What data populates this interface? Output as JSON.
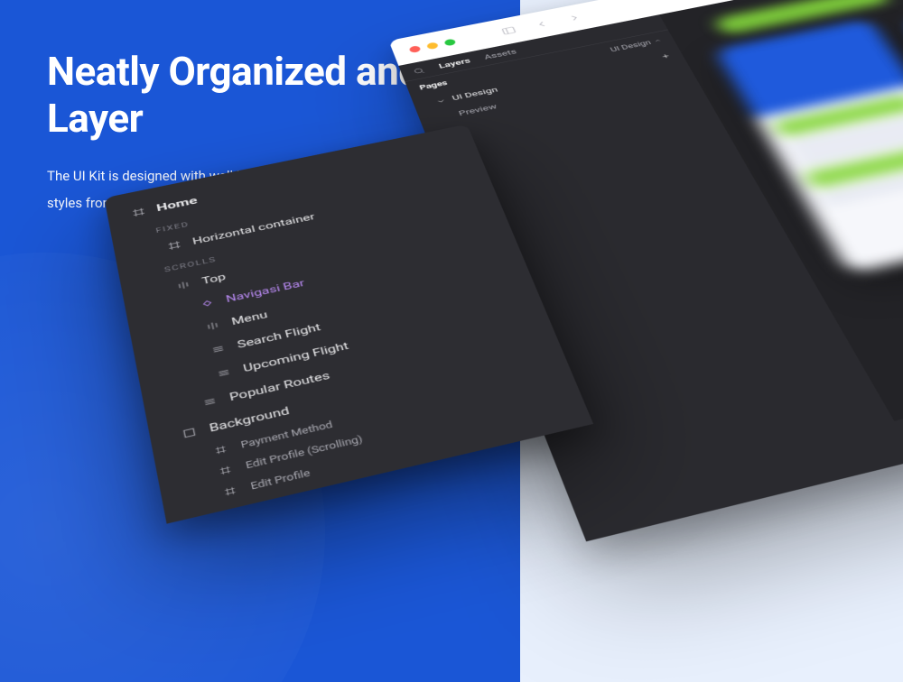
{
  "hero": {
    "title": "Neatly Organized and Layer",
    "subtitle": "The UI Kit is designed with well layered, organized and with free text styles from google font"
  },
  "titlebar": {
    "icons": {
      "sidebar": "sidebar-icon",
      "back": "chevron-left-icon",
      "forward": "chevron-right-icon",
      "shield": "shield-icon"
    }
  },
  "toolbar": {
    "tools": {
      "figma": "figma-logo-icon",
      "move": "move-tool-icon",
      "frame": "frame-tool-icon",
      "pen": "pen-tool-icon",
      "text": "text-tool-icon",
      "component": "component-tool-icon",
      "hand": "hand-tool-icon",
      "comment": "comment-tool-icon"
    }
  },
  "side_panel": {
    "tabs": {
      "layers": "Layers",
      "assets": "Assets"
    },
    "section_label": "Pages",
    "section_current": "UI Design",
    "pages": [
      {
        "name": "UI Design",
        "expanded": true
      },
      {
        "name": "Preview",
        "expanded": false
      }
    ]
  },
  "layers_tree": {
    "root": "Home",
    "sections": {
      "fixed": "FIXED",
      "scrolls": "SCROLLS"
    },
    "items": {
      "horizontal_container": "Horizontal container",
      "top": "Top",
      "navigasi_bar": "Navigasi Bar",
      "menu": "Menu",
      "search_flight": "Search Flight",
      "upcoming_flight": "Upcoming Flight",
      "popular_routes": "Popular Routes",
      "background": "Background",
      "payment_method": "Payment Method",
      "edit_profile_scrolling": "Edit Profile (Scrolling)",
      "edit_profile": "Edit Profile"
    }
  }
}
